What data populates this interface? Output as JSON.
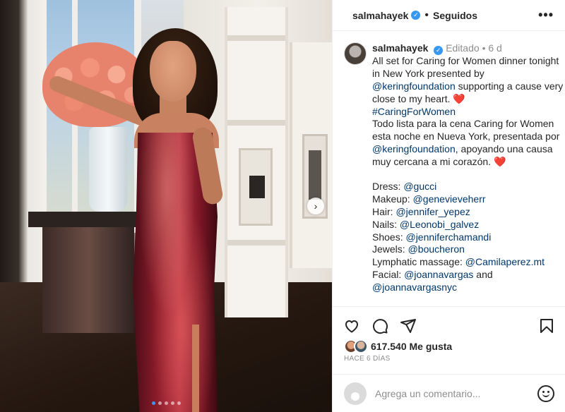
{
  "header": {
    "username": "salmahayek",
    "verified_icon": "verified-badge-icon",
    "separator": "•",
    "follow_status": "Seguidos",
    "more_icon": "more-options-icon",
    "more_label": "•••"
  },
  "photo": {
    "description_icon": "post-photo",
    "next_icon": "chevron-right-icon",
    "next_label": "›",
    "carousel_dots": 5,
    "active_dot": 0
  },
  "caption": {
    "username": "salmahayek",
    "edited": "Editado",
    "separator": "•",
    "time": "6 d",
    "lines": [
      {
        "text": "All set for Caring for Women dinner tonight in New York presented by "
      },
      {
        "link": "@keringfoundation"
      },
      {
        "text": " supporting a cause very close to my heart. "
      },
      {
        "heart": "❤️"
      },
      {
        "link2": "#CaringForWomen"
      },
      {
        "text2": "Todo lista para la cena Caring for Women esta noche en Nueva York, presentada por "
      },
      {
        "link3": "@keringfoundation"
      },
      {
        "text3": ", apoyando una causa muy cercana a mi corazón. "
      },
      {
        "heart2": "❤️"
      }
    ],
    "p1_a": "All set for Caring for Women dinner tonight in New York presented by ",
    "p1_link": "@keringfoundation",
    "p1_b": " supporting a cause very close to my heart. ",
    "p1_heart": "❤️",
    "hashtag": "#CaringForWomen",
    "p2_a": "Todo lista para la cena Caring for Women esta noche en Nueva York, presentada por ",
    "p2_link": "@keringfoundation",
    "p2_b": ", apoyando una causa muy cercana a mi corazón. ",
    "p2_heart": "❤️",
    "credits": [
      {
        "label": "Dress: ",
        "handle": "@gucci"
      },
      {
        "label": "Makeup: ",
        "handle": "@genevieveherr"
      },
      {
        "label": "Hair: ",
        "handle": "@jennifer_yepez"
      },
      {
        "label": "Nails: ",
        "handle": "@Leonobi_galvez"
      },
      {
        "label": "Shoes: ",
        "handle": "@jenniferchamandi"
      },
      {
        "label": "Jewels: ",
        "handle": "@boucheron"
      },
      {
        "label": "Lymphatic massage: ",
        "handle": "@Camilaperez.mt"
      },
      {
        "label": "Facial: ",
        "handle": "@joannavargas"
      }
    ],
    "facial_and": " and",
    "last_handle": "@joannavargasnyc"
  },
  "actions": {
    "like_icon": "heart-icon",
    "comment_icon": "comment-icon",
    "share_icon": "share-icon",
    "save_icon": "bookmark-icon"
  },
  "likes": {
    "count": "617.540",
    "label": " Me gusta"
  },
  "date": "HACE 6 DÍAS",
  "comment": {
    "placeholder": "Agrega un comentario...",
    "emoji_icon": "emoji-icon"
  },
  "colors": {
    "link": "#00376b",
    "verified": "#3897f0",
    "meta": "#8e8e8e",
    "heart": "#ed1c24"
  }
}
